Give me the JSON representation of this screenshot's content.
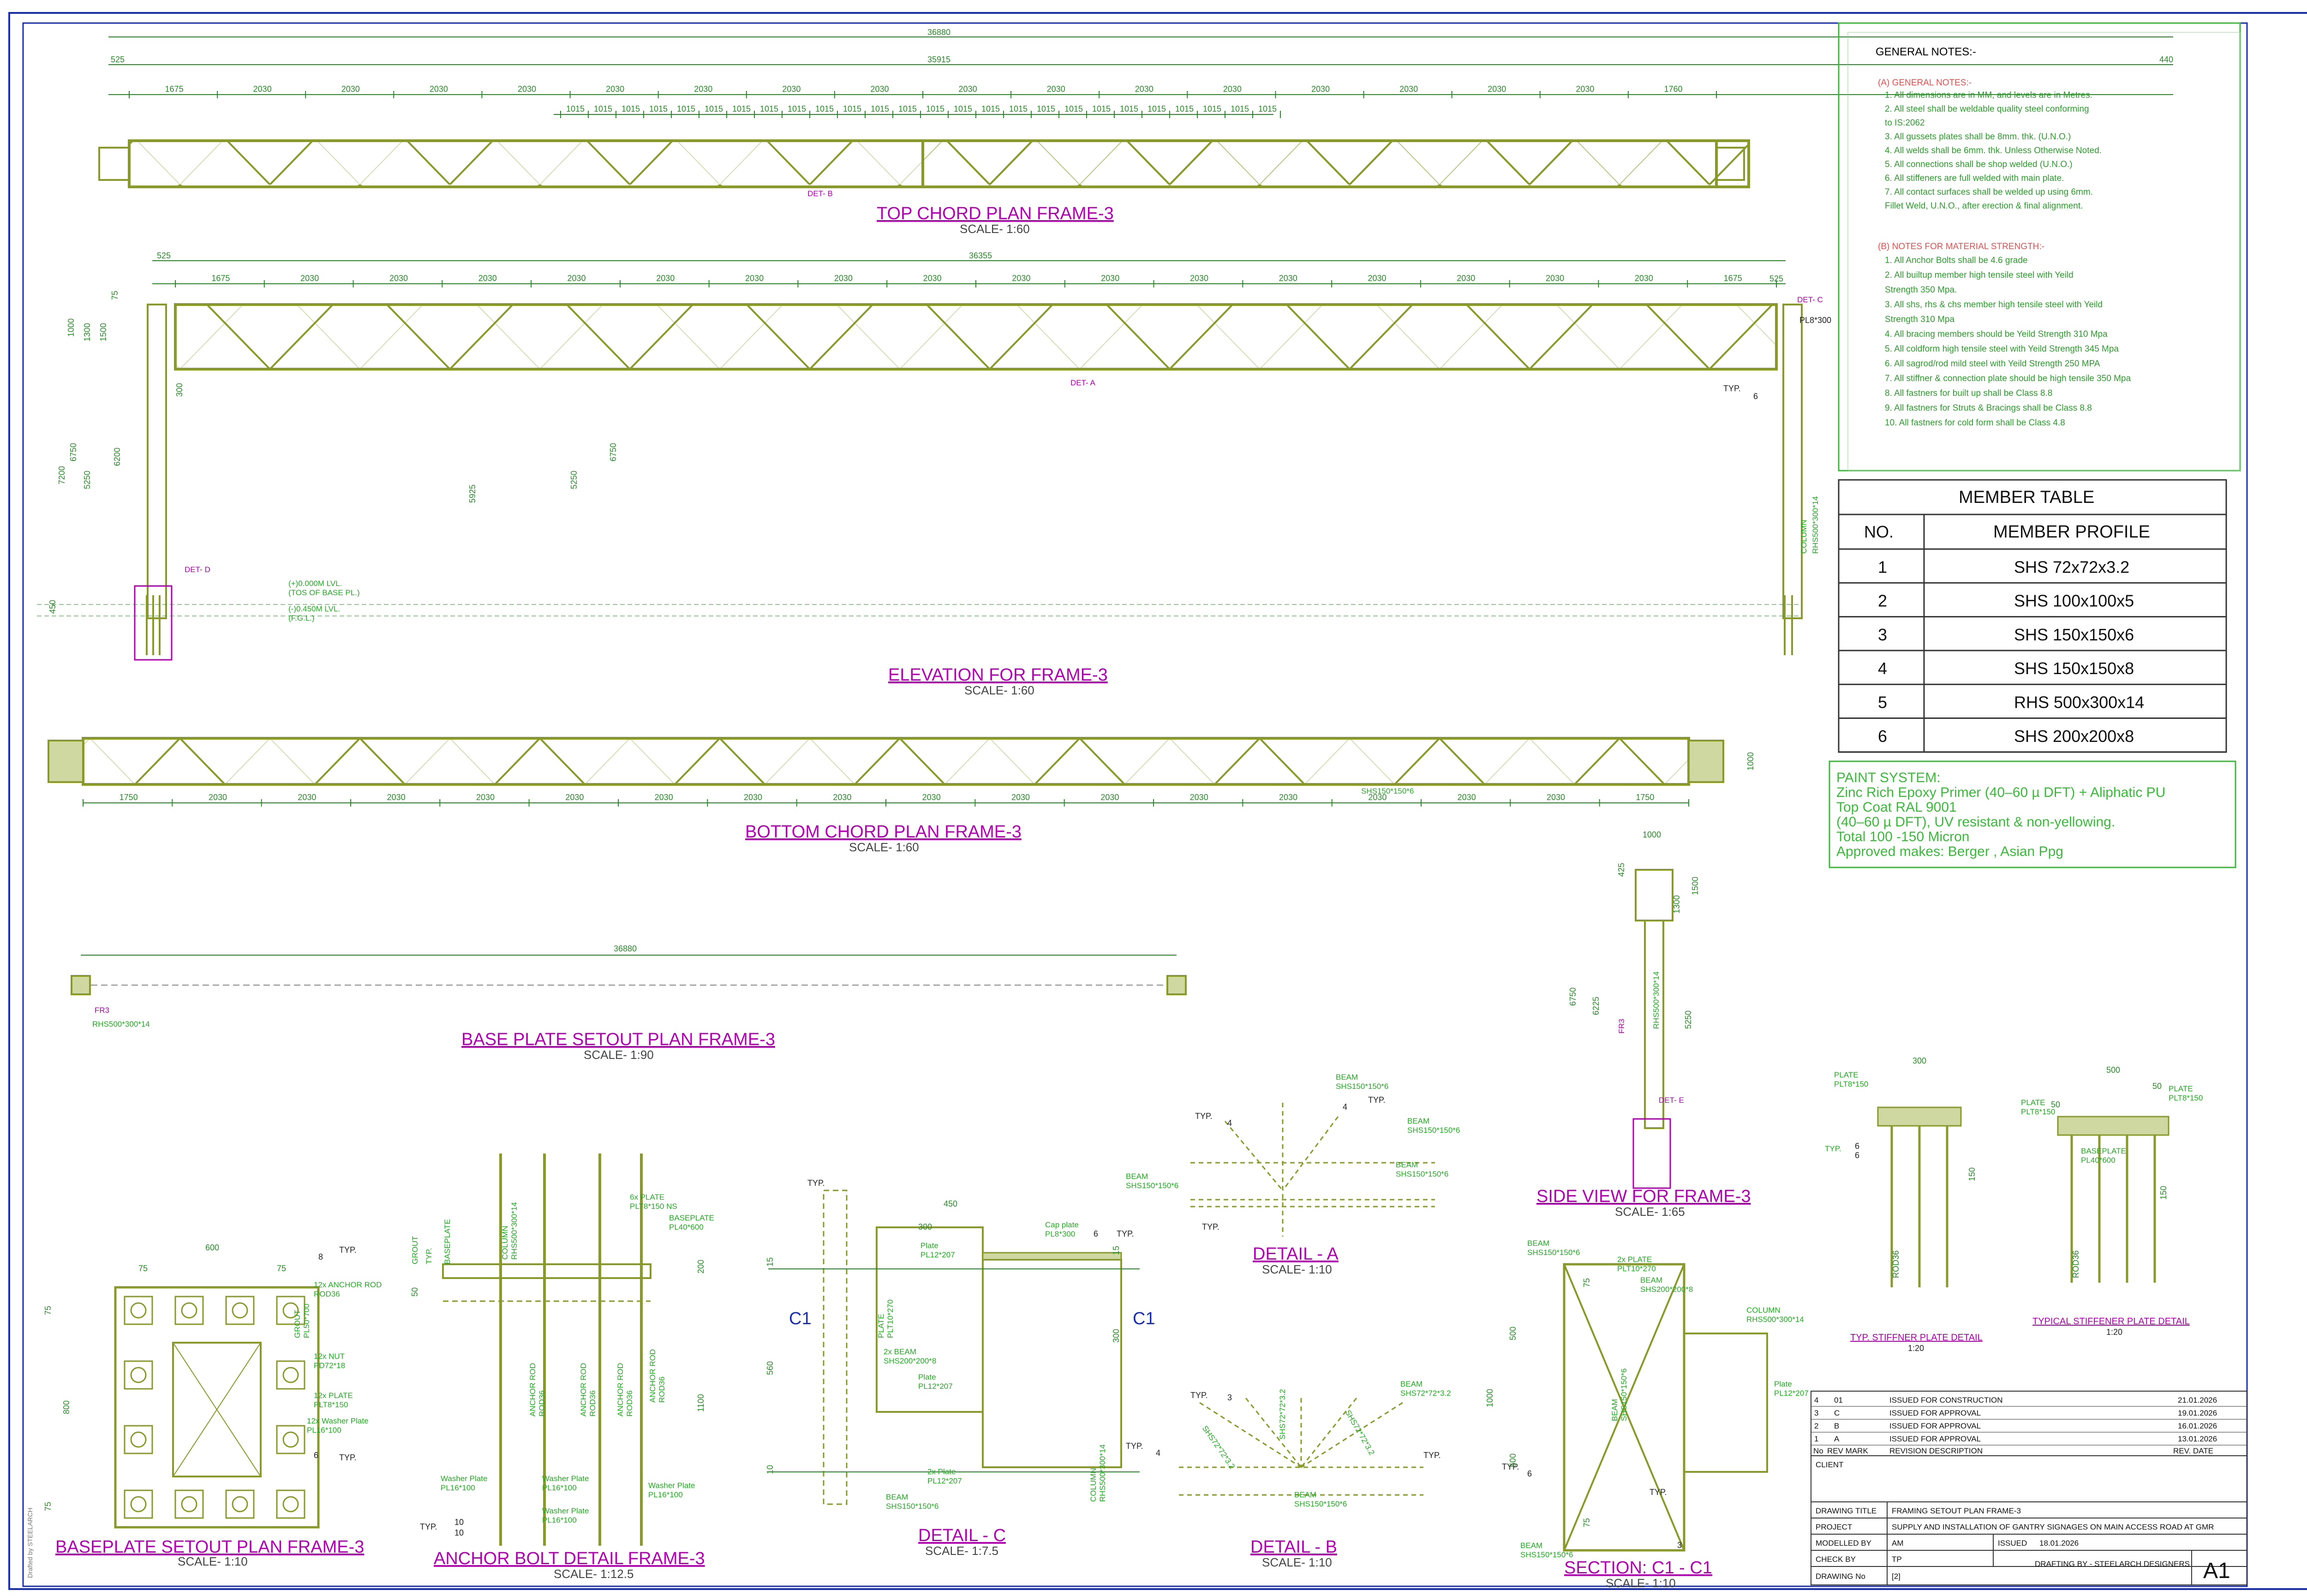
{
  "colors": {
    "frame": "#1a2fb0",
    "member": "#8a9a2a",
    "dim": "#2a8a2a",
    "label": "#22aa22",
    "title": "#b000b0",
    "green_box": "#3cb83c"
  },
  "general_notes": {
    "heading": "GENERAL NOTES:-",
    "sec_a": "(A) GENERAL NOTES:-",
    "a": [
      "1. All dimensions are in MM, and levels are in Metres.",
      "2. All steel shall be weldable quality steel conforming",
      "to IS:2062",
      "3. All gussets plates shall be 8mm. thk. (U.N.O.)",
      "4. All welds shall be 6mm. thk. Unless Otherwise Noted.",
      "5. All connections shall be shop welded (U.N.O.)",
      "6. All stiffeners are full welded with main plate.",
      "7. All contact surfaces shall be welded up using 6mm.",
      "Fillet Weld, U.N.O., after erection & final alignment."
    ],
    "sec_b": "(B) NOTES FOR MATERIAL STRENGTH:-",
    "b": [
      "1. All Anchor Bolts shall be 4.6 grade",
      "2. All builtup member high tensile steel with Yeild",
      "Strength 350 Mpa.",
      "3. All shs, rhs & chs member high tensile steel with Yeild",
      "Strength 310 Mpa",
      "4. All bracing members should be Yeild Strength 310 Mpa",
      "5. All coldform high tensile steel with Yeild Strength 345 Mpa",
      "6. All sagrod/rod mild steel with Yeild Strength 250 MPA",
      "7. All stiffner & connection plate should be high tensile 350 Mpa",
      "8. All fastners for built up shall be Class 8.8",
      "9. All fastners for Struts & Bracings shall be Class 8.8",
      "10. All fastners for cold form shall be Class 4.8"
    ]
  },
  "member_table": {
    "title": "MEMBER TABLE",
    "h_no": "NO.",
    "h_profile": "MEMBER PROFILE",
    "rows": [
      {
        "no": "1",
        "profile": "SHS 72x72x3.2"
      },
      {
        "no": "2",
        "profile": "SHS 100x100x5"
      },
      {
        "no": "3",
        "profile": "SHS 150x150x6"
      },
      {
        "no": "4",
        "profile": "SHS 150x150x8"
      },
      {
        "no": "5",
        "profile": "RHS 500x300x14"
      },
      {
        "no": "6",
        "profile": "SHS 200x200x8"
      }
    ]
  },
  "paint": [
    "PAINT SYSTEM:",
    "Zinc Rich Epoxy Primer (40–60 µ DFT) + Aliphatic PU",
    "Top Coat RAL 9001",
    "(40–60 µ DFT), UV resistant & non-yellowing.",
    "Total 100 -150 Micron",
    "Approved makes: Berger , Asian Ppg"
  ],
  "views": {
    "top": {
      "title": "TOP CHORD PLAN FRAME-3",
      "scale": "SCALE- 1:60",
      "overall": "36880",
      "inner": "35915",
      "left": "525",
      "right": "440",
      "bays": [
        "1675",
        "2030",
        "2030",
        "2030",
        "2030",
        "2030",
        "2030",
        "2030",
        "2030",
        "2030",
        "2030",
        "2030",
        "2030",
        "2030",
        "2030",
        "2030",
        "2030",
        "1760"
      ],
      "sub": [
        "1015",
        "1015",
        "1015",
        "1015",
        "1015",
        "1015",
        "1015",
        "1015",
        "1015",
        "1015",
        "1015",
        "1015",
        "1015",
        "1015",
        "1015",
        "1015",
        "1015",
        "1015",
        "1015",
        "1015",
        "1015",
        "1015",
        "1015",
        "1015",
        "1015",
        "1015"
      ],
      "det": "DET- B"
    },
    "elev": {
      "title": "ELEVATION FOR FRAME-3",
      "scale": "SCALE- 1:60",
      "overall": "36355",
      "left": "525",
      "right": "525",
      "bays": [
        "1675",
        "2030",
        "2030",
        "2030",
        "2030",
        "2030",
        "2030",
        "2030",
        "2030",
        "2030",
        "2030",
        "2030",
        "2030",
        "2030",
        "2030",
        "2030",
        "2030",
        "1675"
      ],
      "det_a": "DET- A",
      "det_c": "DET- C",
      "det_d": "DET- D",
      "typ": "TYP.",
      "typ_n": "6",
      "pl": "PL8*300",
      "col": "COLUMN",
      "col_rhs": "RHS500*300*14",
      "lvl1": "(+)0.000M LVL.",
      "lvl1b": "(TOS OF BASE PL.)",
      "lvl2": "(-)0.450M LVL.",
      "lvl2b": "(F.G.L.)",
      "v": [
        "7200",
        "6750",
        "5250",
        "6200",
        "1500",
        "1300",
        "1000",
        "75",
        "450",
        "300",
        "5925",
        "5250",
        "6750"
      ]
    },
    "bottom": {
      "title": "BOTTOM CHORD PLAN FRAME-3",
      "scale": "SCALE- 1:60",
      "bays": [
        "1750",
        "2030",
        "2030",
        "2030",
        "2030",
        "2030",
        "2030",
        "2030",
        "2030",
        "2030",
        "2030",
        "2030",
        "2030",
        "2030",
        "2030",
        "2030",
        "2030",
        "1750"
      ],
      "side": "1000",
      "mem": "SHS150*150*6"
    },
    "base": {
      "title": "BASE PLATE SETOUT PLAN FRAME-3",
      "scale": "SCALE- 1:90",
      "dim": "36880",
      "tag": "FR3",
      "mem": "RHS500*300*14"
    },
    "side": {
      "title": "SIDE VIEW FOR FRAME-3",
      "scale": "SCALE- 1:65",
      "dims": [
        "1000",
        "425",
        "1500",
        "1300",
        "6750",
        "6225",
        "5250"
      ],
      "col": "RHS500*300*14",
      "tag": "FR3",
      "det": "DET- E"
    },
    "bp": {
      "title": "BASEPLATE SETOUT PLAN FRAME-3",
      "scale": "SCALE- 1:10",
      "w": "600",
      "h": "800",
      "typ": "TYP.",
      "n8": "8",
      "n6": "6",
      "l1": "12x ANCHOR ROD",
      "l1b": "ROD36",
      "l2": "GROUT",
      "l2b": "PL50*700",
      "l3": "12x NUT",
      "l3b": "PD72*18",
      "l4": "12x PLATE",
      "l4b": "PLT8*150",
      "l5": "12x Washer Plate",
      "l5b": "PL16*100",
      "e1": "75",
      "e2": "75",
      "e3": "600",
      "e4": "75",
      "e5": "75"
    },
    "anchor": {
      "title": "ANCHOR BOLT DETAIL FRAME-3",
      "scale": "SCALE- 1:12.5",
      "col": "COLUMN",
      "col2": "RHS500*300*14",
      "plate": "6x PLATE",
      "plate2": "PLT8*150 NS",
      "bp": "BASEPLATE",
      "bp2": "PL40*600",
      "rod": "ANCHOR ROD",
      "rod2": "ROD36",
      "wp": "Washer Plate",
      "wp2": "PL16*100",
      "grout": "GROUT",
      "typ": "TYP.",
      "n10": "10",
      "n10b": "10",
      "d1": "50",
      "d2": "200",
      "d3": "1100",
      "v1": "TYP.",
      "v2": "BASEPLATE"
    },
    "detc": {
      "title": "DETAIL - C",
      "scale": "SCALE- 1:7.5",
      "c1": "C1",
      "c1b": "C1",
      "typ": "TYP.",
      "n6": "6",
      "capp": "Cap plate",
      "capp2": "PL8*300",
      "w450": "450",
      "w300": "300",
      "pl1": "Plate",
      "pl1b": "PL12*207",
      "pl2": "PLATE",
      "pl2b": "PLT10*270",
      "beam": "2x BEAM",
      "beam2": "SHS200*200*8",
      "pl3": "Plate",
      "pl3b": "PL12*207",
      "pl4": "2x Plate",
      "pl4b": "PL12*207",
      "bm": "BEAM",
      "bm2": "SHS150*150*6",
      "col": "COLUMN",
      "col2": "RHS500*300*14",
      "v1": "15",
      "v2": "560",
      "v3": "300",
      "v4": "10",
      "v5": "15"
    },
    "deta": {
      "title": "DETAIL - A",
      "scale": "SCALE- 1:10",
      "b1": "BEAM",
      "b1b": "SHS150*150*6",
      "b2": "BEAM",
      "b2b": "SHS150*150*6",
      "b3": "BEAM",
      "b3b": "SHS150*150*6",
      "b4": "BEAM",
      "b4b": "SHS150*150*6",
      "typ": "TYP.",
      "n4": "4",
      "n4b": "4"
    },
    "detb": {
      "title": "DETAIL - B",
      "scale": "SCALE- 1:10",
      "b1": "BEAM",
      "b1b": "SHS72*72*3.2",
      "b2": "BEAM",
      "b2b": "SHS150*150*6",
      "typ": "TYP.",
      "n3": "3",
      "n4": "4",
      "m1": "SHS72*72*3.2",
      "m2": "SHS72*72*3.2",
      "m3": "SHS72*72*3.2"
    },
    "sec": {
      "title": "SECTION: C1 - C1",
      "scale": "SCALE- 1:10",
      "b1": "BEAM",
      "b1b": "SHS150*150*6",
      "p1": "2x PLATE",
      "p1b": "PLT10*270",
      "b2": "BEAM",
      "b2b": "SHS200*200*8",
      "col": "COLUMN",
      "col2": "RHS500*300*14",
      "pl": "Plate",
      "plb": "PL12*207",
      "b3": "BEAM",
      "b3b": "SHS150*150*6",
      "b4": "BEAM",
      "b4b": "SHS150*150*6",
      "typ": "TYP.",
      "d1": "1000",
      "d2": "500",
      "d3": "500",
      "d4": "75",
      "d5": "75",
      "n6": "6",
      "n3": "3"
    },
    "stif1": {
      "title": "TYP. STIFFNER PLATE DETAIL",
      "scale": "1:20",
      "pl": "PLATE",
      "pl2": "PLT8*150",
      "w": "300",
      "typ": "TYP.",
      "n6": "6",
      "d": "150",
      "rod": "ROD36"
    },
    "stif2": {
      "title": "TYPICAL STIFFENER PLATE DETAIL",
      "scale": "1:20",
      "pl": "PLATE",
      "pl2": "PLT8*150",
      "pl3": "PLATE",
      "pl4": "PLT8*150",
      "bp": "BASEPLATE",
      "bp2": "PL40*600",
      "w": "500",
      "d1": "50",
      "d2": "50",
      "d3": "150",
      "rod": "ROD36"
    }
  },
  "revisions": {
    "rows": [
      {
        "no": "4",
        "mark": "01",
        "desc": "ISSUED FOR CONSTRUCTION",
        "date": "21.01.2026"
      },
      {
        "no": "3",
        "mark": "C",
        "desc": "ISSUED FOR APPROVAL",
        "date": "19.01.2026"
      },
      {
        "no": "2",
        "mark": "B",
        "desc": "ISSUED FOR APPROVAL",
        "date": "16.01.2026"
      },
      {
        "no": "1",
        "mark": "A",
        "desc": "ISSUED FOR APPROVAL",
        "date": "13.01.2026"
      }
    ],
    "h_no": "No",
    "h_mark": "REV MARK",
    "h_desc": "REVISION DESCRIPTION",
    "h_date": "REV. DATE"
  },
  "title_block": {
    "client": "CLIENT",
    "dt_label": "DRAWING TITLE",
    "dt": "FRAMING SETOUT PLAN FRAME-3",
    "proj_label": "PROJECT",
    "proj": "SUPPLY AND INSTALLATION OF  GANTRY SIGNAGES ON MAIN ACCESS ROAD AT GMR",
    "mod_label": "MODELLED BY",
    "mod": "AM",
    "issued_label": "ISSUED",
    "issued": "18.01.2026",
    "chk_label": "CHECK BY",
    "chk": "TP",
    "dno_label": "DRAWING No",
    "dno": "[2]",
    "drafting": "DRAFTING BY - STEELARCH DESIGNERS",
    "size": "A1"
  },
  "margin_note": "Drafted by STEELARCH"
}
